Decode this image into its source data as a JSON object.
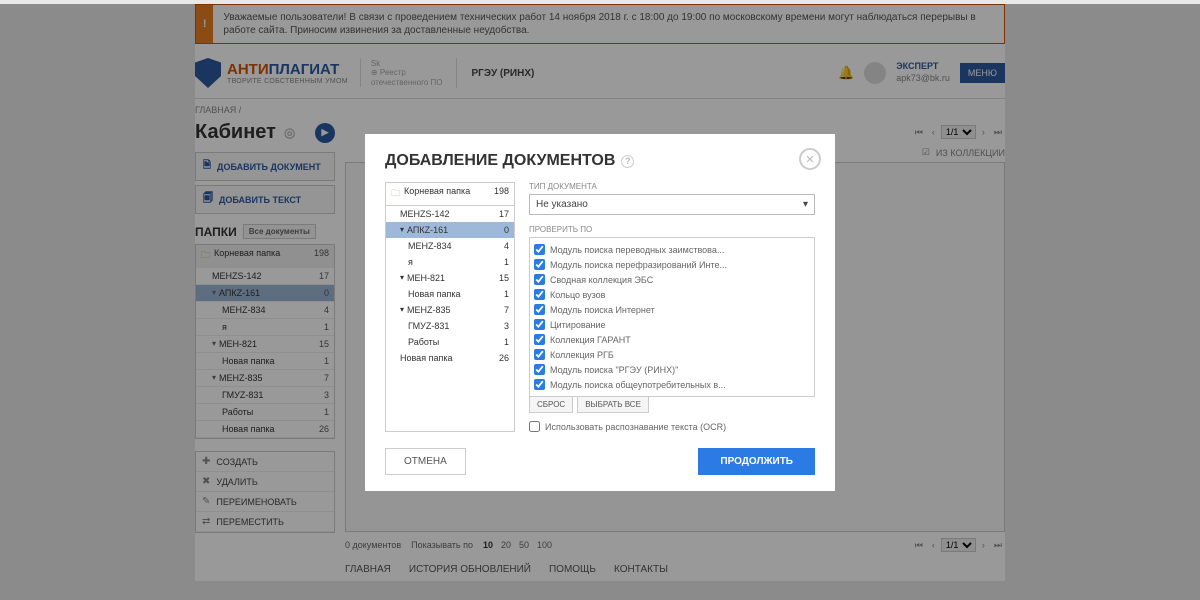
{
  "alert": "Уважаемые пользователи! В связи с проведением технических работ 14 ноября 2018 г. с 18:00 до 19:00 по московскому времени могут наблюдаться перерывы в работе сайта. Приносим извинения за доставленные неудобства.",
  "logo": {
    "part1": "АНТИ",
    "part2": "ПЛАГИАТ",
    "tagline": "ТВОРИТЕ СОБСТВЕННЫМ УМОМ"
  },
  "sk": {
    "l1": "Sk",
    "l2": "Реестр",
    "l3": "отечественного ПО"
  },
  "university": "РГЭУ (РИНХ)",
  "user": {
    "role": "ЭКСПЕРТ",
    "email": "apk73@bk.ru"
  },
  "menu_btn": "МЕНЮ",
  "breadcrumb": "ГЛАВНАЯ /",
  "cabinet": "Кабинет",
  "side_buttons": {
    "add_doc": "ДОБАВИТЬ ДОКУМЕНТ",
    "add_text": "ДОБАВИТЬ ТЕКСТ"
  },
  "folders_title": "ПАПКИ",
  "all_docs": "Все документы",
  "folders": [
    {
      "name": "Корневая папка",
      "count": "198",
      "cls": "root"
    },
    {
      "name": "МЕНZS-142",
      "count": "17",
      "cls": "indent1"
    },
    {
      "name": "АПКZ-161",
      "count": "0",
      "cls": "indent1 selected-apkz",
      "arr": "▾"
    },
    {
      "name": "МЕНZ-834",
      "count": "4",
      "cls": "indent2"
    },
    {
      "name": "я",
      "count": "1",
      "cls": "indent2"
    },
    {
      "name": "МЕН-821",
      "count": "15",
      "cls": "indent1",
      "arr": "▾"
    },
    {
      "name": "Новая папка",
      "count": "1",
      "cls": "indent2"
    },
    {
      "name": "МЕНZ-835",
      "count": "7",
      "cls": "indent1",
      "arr": "▾"
    },
    {
      "name": "ГМУZ-831",
      "count": "3",
      "cls": "indent2"
    },
    {
      "name": "Работы",
      "count": "1",
      "cls": "indent2"
    },
    {
      "name": "Новая папка",
      "count": "26",
      "cls": "indent2"
    }
  ],
  "actions": [
    {
      "icon": "✚",
      "label": "СОЗДАТЬ"
    },
    {
      "icon": "✖",
      "label": "УДАЛИТЬ"
    },
    {
      "icon": "✎",
      "label": "ПЕРЕИМЕНОВАТЬ"
    },
    {
      "icon": "⇄",
      "label": "ПЕРЕМЕСТИТЬ"
    }
  ],
  "toolbar_right": "ИЗ КОЛЛЕКЦИИ",
  "pager_val": "1/1",
  "footer": {
    "count": "0 документов",
    "show": "Показывать по",
    "opts": [
      "10",
      "20",
      "50",
      "100"
    ]
  },
  "nav": [
    "ГЛАВНАЯ",
    "ИСТОРИЯ ОБНОВЛЕНИЙ",
    "ПОМОЩЬ",
    "КОНТАКТЫ"
  ],
  "modal": {
    "title": "ДОБАВЛЕНИЕ ДОКУМЕНТОВ",
    "folders": [
      {
        "name": "Корневая папка",
        "count": "198",
        "cls": "root"
      },
      {
        "name": "МЕНZS-142",
        "count": "17",
        "cls": "i1"
      },
      {
        "name": "АПКZ-161",
        "count": "0",
        "cls": "i1 sel",
        "arr": "▾"
      },
      {
        "name": "МЕНZ-834",
        "count": "4",
        "cls": "i2"
      },
      {
        "name": "я",
        "count": "1",
        "cls": "i2"
      },
      {
        "name": "МЕН-821",
        "count": "15",
        "cls": "i1",
        "arr": "▾"
      },
      {
        "name": "Новая папка",
        "count": "1",
        "cls": "i2"
      },
      {
        "name": "МЕНZ-835",
        "count": "7",
        "cls": "i1",
        "arr": "▾"
      },
      {
        "name": "ГМУZ-831",
        "count": "3",
        "cls": "i2"
      },
      {
        "name": "Работы",
        "count": "1",
        "cls": "i2"
      },
      {
        "name": "Новая папка",
        "count": "26",
        "cls": "i1"
      }
    ],
    "doc_type_label": "ТИП ДОКУМЕНТА",
    "doc_type_value": "Не указано",
    "check_label": "ПРОВЕРИТЬ ПО",
    "checks": [
      "Модуль поиска переводных заимствова...",
      "Модуль поиска перефразирований Инте...",
      "Сводная коллекция ЭБС",
      "Кольцо вузов",
      "Модуль поиска Интернет",
      "Цитирование",
      "Коллекция ГАРАНТ",
      "Коллекция РГБ",
      "Модуль поиска \"РГЭУ (РИНХ)\"",
      "Модуль поиска общеупотребительных в..."
    ],
    "reset": "СБРОС",
    "select_all": "ВЫБРАТЬ ВСЕ",
    "ocr": "Использовать распознавание текста (OCR)",
    "cancel": "ОТМЕНА",
    "continue": "ПРОДОЛЖИТЬ"
  }
}
